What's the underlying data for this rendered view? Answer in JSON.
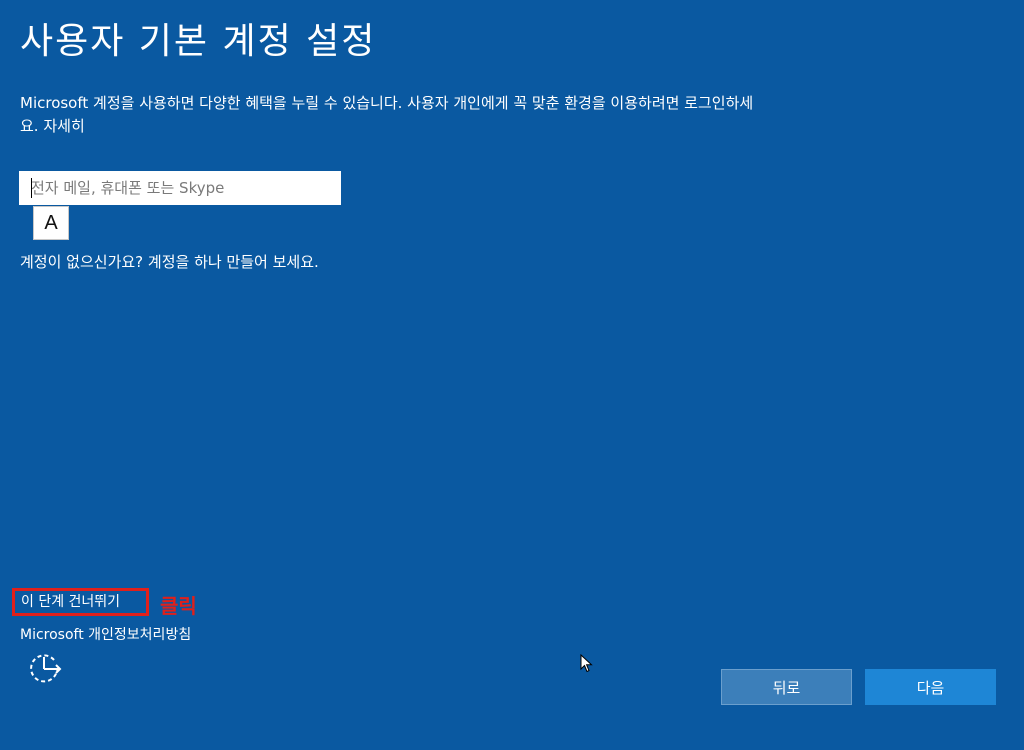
{
  "page": {
    "title": "사용자 기본 계정 설정",
    "description": "Microsoft 계정을 사용하면 다양한 혜택을 누릴 수 있습니다. 사용자 개인에게 꼭 맞춘 환경을 이용하려면 로그인하세요.",
    "learn_more": "자세히"
  },
  "email_input": {
    "placeholder": "전자 메일, 휴대폰 또는 Skype",
    "value": "",
    "ime_indicator": "A"
  },
  "no_account_link": "계정이 없으신가요? 계정을 하나 만들어 보세요.",
  "skip_link": "이 단계 건너뛰기",
  "annotation": "클릭",
  "privacy_link": "Microsoft 개인정보처리방침",
  "buttons": {
    "back": "뒤로",
    "next": "다음"
  },
  "colors": {
    "background": "#0a59a1",
    "highlight": "#e0201b",
    "next_button": "#1e86d6"
  },
  "icons": {
    "ease_of_access": "ease-of-access-icon",
    "mouse_cursor": "mouse-pointer-icon"
  }
}
